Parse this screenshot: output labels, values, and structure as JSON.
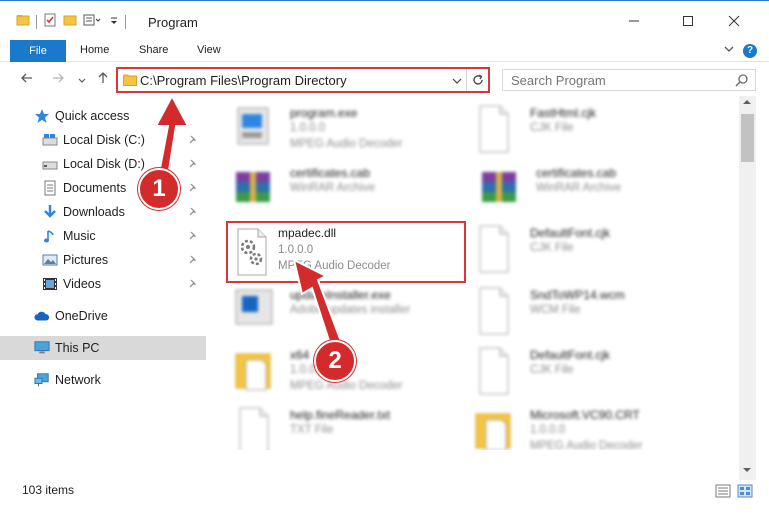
{
  "window": {
    "title": "Program"
  },
  "ribbon": {
    "file": "File",
    "home": "Home",
    "share": "Share",
    "view": "View"
  },
  "address": {
    "path": "C:\\Program Files\\Program Directory"
  },
  "search": {
    "placeholder": "Search Program"
  },
  "sidebar": {
    "items": [
      {
        "label": "Quick access",
        "icon": "star-icon"
      },
      {
        "label": "Local Disk (C:)",
        "icon": "drive-icon"
      },
      {
        "label": "Local Disk (D:)",
        "icon": "drive-icon"
      },
      {
        "label": "Documents",
        "icon": "documents-icon"
      },
      {
        "label": "Downloads",
        "icon": "downloads-icon"
      },
      {
        "label": "Music",
        "icon": "music-icon"
      },
      {
        "label": "Pictures",
        "icon": "pictures-icon"
      },
      {
        "label": "Videos",
        "icon": "videos-icon"
      },
      {
        "label": "OneDrive",
        "icon": "cloud-icon"
      },
      {
        "label": "This PC",
        "icon": "computer-icon"
      },
      {
        "label": "Network",
        "icon": "network-icon"
      }
    ]
  },
  "files": [
    {
      "name": "program.exe",
      "line2": "1.0.0.0",
      "line3": "MPEG Audio Decoder",
      "type": "exe"
    },
    {
      "name": "FastHtml.cjk",
      "line2": "CJK File",
      "line3": "",
      "type": "doc"
    },
    {
      "name": "certificates.cab",
      "line2": "WinRAR Archive",
      "line3": "",
      "type": "rar"
    },
    {
      "name": "certificates.cab",
      "line2": "WinRAR Archive",
      "line3": "",
      "type": "rar"
    },
    {
      "name": "mpadec.dll",
      "line2": "1.0.0.0",
      "line3": "MPEG Audio Decoder",
      "type": "dll"
    },
    {
      "name": "DefaultFont.cjk",
      "line2": "CJK File",
      "line3": "",
      "type": "doc"
    },
    {
      "name": "updateInstaller.exe",
      "line2": "Adobe updates installer",
      "line3": "",
      "type": "installer"
    },
    {
      "name": "SndToWP14.wcm",
      "line2": "WCM File",
      "line3": "",
      "type": "doc"
    },
    {
      "name": "x64",
      "line2": "1.0.0.0",
      "line3": "MPEG Audio Decoder",
      "type": "folderdoc"
    },
    {
      "name": "DefaultFont.cjk",
      "line2": "CJK File",
      "line3": "",
      "type": "doc"
    },
    {
      "name": "help.fineReader.txt",
      "line2": "TXT File",
      "line3": "",
      "type": "doc"
    },
    {
      "name": "Microsoft.VC90.CRT",
      "line2": "1.0.0.0",
      "line3": "MPEG Audio Decoder",
      "type": "folderdoc"
    }
  ],
  "status": {
    "count": "103 items"
  },
  "annotations": {
    "one": "1",
    "two": "2"
  },
  "colors": {
    "accent": "#1979ca",
    "highlight": "#d9383a",
    "badge": "#d32a2c"
  }
}
